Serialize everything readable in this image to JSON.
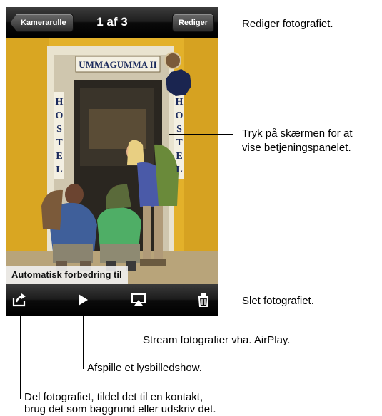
{
  "nav": {
    "back_label": "Kamerarulle",
    "title": "1 af 3",
    "edit_label": "Rediger"
  },
  "photo": {
    "sign_text": "UMMAGUMMA II",
    "left_sign": "HOSTEL",
    "right_sign": "HOSTEL",
    "enhance_label": "Automatisk forbedring til"
  },
  "toolbar": {
    "share_icon": "share-icon",
    "play_icon": "play-icon",
    "airplay_icon": "airplay-icon",
    "trash_icon": "trash-icon"
  },
  "callouts": {
    "edit": "Rediger fotografiet.",
    "tap_line1": "Tryk på skærmen for at",
    "tap_line2": "vise betjeningspanelet.",
    "delete": "Slet fotografiet.",
    "airplay": "Stream fotografier vha. AirPlay.",
    "slideshow": "Afspille et lysbilledshow.",
    "share_line1": "Del fotografiet, tildel det til en kontakt,",
    "share_line2": "brug det som baggrund eller udskriv det."
  },
  "colors": {
    "wall": "#e7b528",
    "toolbar": "#1c1c1c"
  }
}
